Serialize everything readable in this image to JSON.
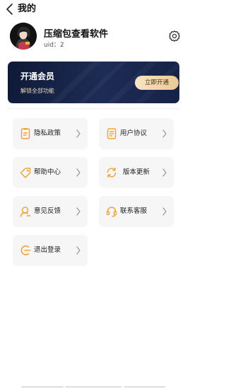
{
  "nav": {
    "back_icon": "chevron-left-icon",
    "title": "我的"
  },
  "profile": {
    "name": "压缩包查看软件",
    "uid_label": "uid：",
    "uid_value": "2",
    "settings_icon": "gear-icon"
  },
  "vip": {
    "title": "开通会员",
    "subtitle": "解锁全部功能",
    "button": "立即开通"
  },
  "menu": [
    {
      "label": "隐私政策",
      "icon": "document-icon"
    },
    {
      "label": "用户协议",
      "icon": "document-list-icon"
    },
    {
      "label": "帮助中心",
      "icon": "tag-icon"
    },
    {
      "label": "版本更新",
      "icon": "refresh-icon"
    },
    {
      "label": "意见反馈",
      "icon": "feedback-person-icon"
    },
    {
      "label": "联系客服",
      "icon": "headset-icon"
    },
    {
      "label": "退出登录",
      "icon": "logout-icon"
    }
  ],
  "colors": {
    "accent": "#f0a33a",
    "vip_bg": "#1b2a52",
    "card_bg": "#f6f6f6"
  }
}
